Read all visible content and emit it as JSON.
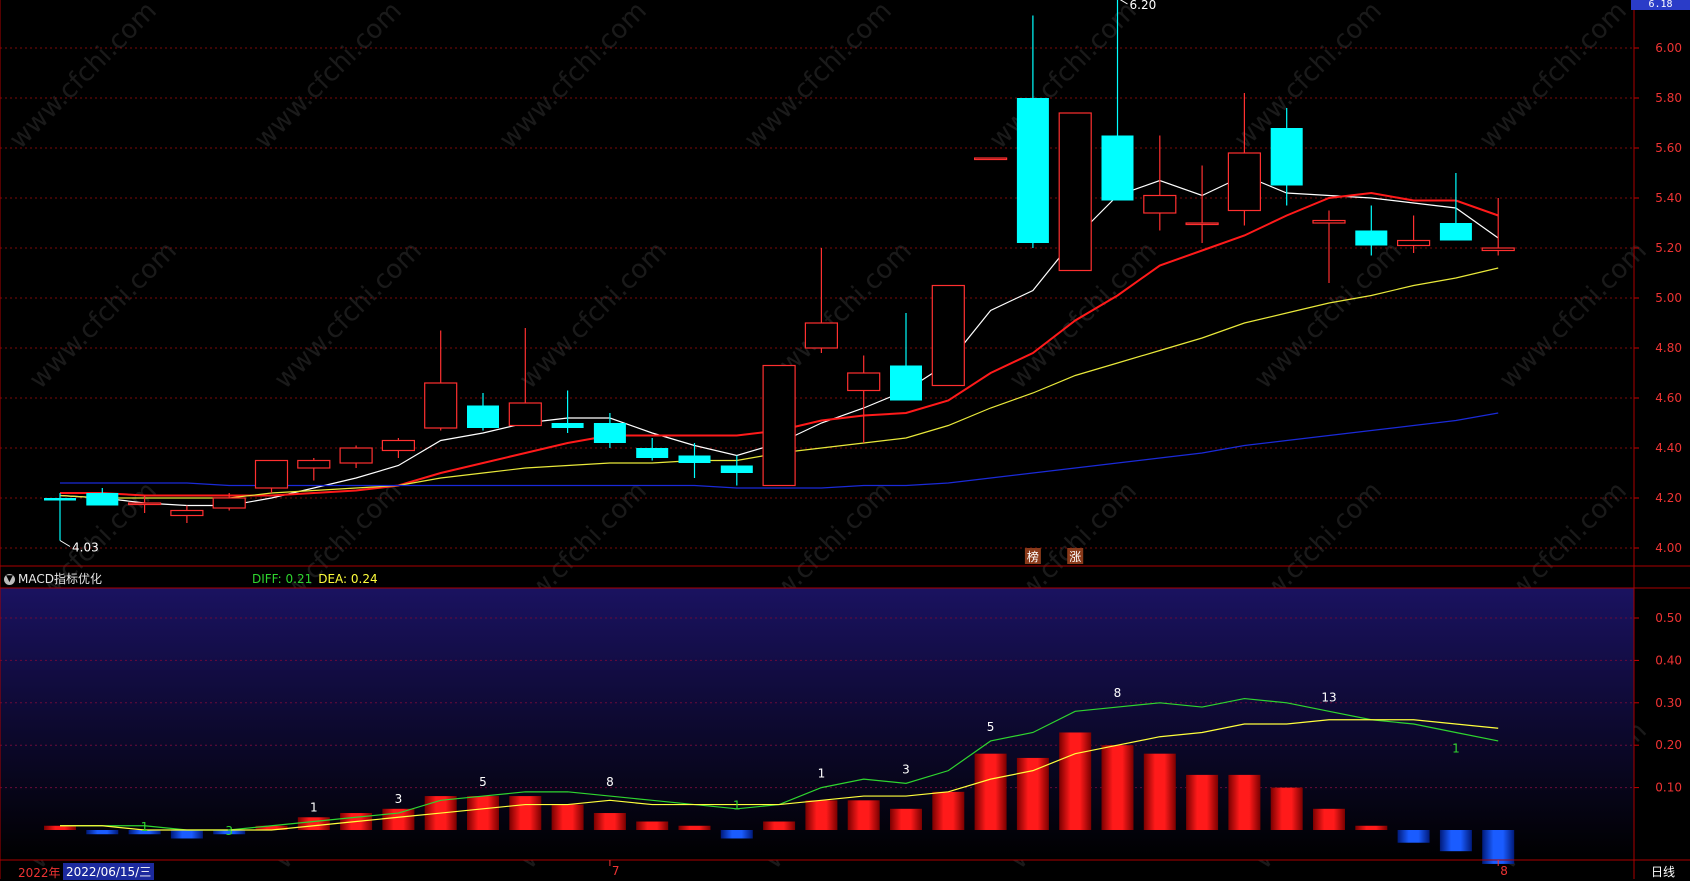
{
  "header_badge": "6.18",
  "macd_panel": {
    "title": "MACD指标优化",
    "diff_label": "DIFF: 0.21",
    "dea_label": "DEA: 0.24"
  },
  "bottom_axis": {
    "year": "2022年",
    "cursor_date": "2022/06/15/三",
    "period": "日线",
    "month_marks": [
      "7",
      "8"
    ]
  },
  "chart_data": [
    {
      "type": "candlestick",
      "yaxis_ticks": [
        "4.00",
        "4.20",
        "4.40",
        "4.60",
        "4.80",
        "5.00",
        "5.20",
        "5.40",
        "5.60",
        "5.80",
        "6.00"
      ],
      "ylim": [
        3.98,
        6.23
      ],
      "high_label": "6.20",
      "low_label": "4.03",
      "markers": [
        "榜",
        "涨"
      ],
      "colors": {
        "up": "#ff3030",
        "down": "#00ffff",
        "ma5": "#ffffff",
        "ma10": "#ff1a1a",
        "ma20": "#e8e83a",
        "ma60": "#1a2ad8"
      },
      "candles": [
        {
          "o": 4.2,
          "h": 4.22,
          "l": 4.03,
          "c": 4.19
        },
        {
          "o": 4.22,
          "h": 4.24,
          "l": 4.17,
          "c": 4.17
        },
        {
          "o": 4.18,
          "h": 4.21,
          "l": 4.14,
          "c": 4.18
        },
        {
          "o": 4.13,
          "h": 4.17,
          "l": 4.1,
          "c": 4.15
        },
        {
          "o": 4.16,
          "h": 4.22,
          "l": 4.15,
          "c": 4.2
        },
        {
          "o": 4.24,
          "h": 4.35,
          "l": 4.22,
          "c": 4.35
        },
        {
          "o": 4.32,
          "h": 4.36,
          "l": 4.27,
          "c": 4.35
        },
        {
          "o": 4.34,
          "h": 4.41,
          "l": 4.32,
          "c": 4.4
        },
        {
          "o": 4.39,
          "h": 4.44,
          "l": 4.36,
          "c": 4.43
        },
        {
          "o": 4.48,
          "h": 4.87,
          "l": 4.47,
          "c": 4.66
        },
        {
          "o": 4.57,
          "h": 4.62,
          "l": 4.47,
          "c": 4.48
        },
        {
          "o": 4.49,
          "h": 4.88,
          "l": 4.49,
          "c": 4.58
        },
        {
          "o": 4.5,
          "h": 4.63,
          "l": 4.46,
          "c": 4.48
        },
        {
          "o": 4.5,
          "h": 4.54,
          "l": 4.4,
          "c": 4.42
        },
        {
          "o": 4.4,
          "h": 4.44,
          "l": 4.35,
          "c": 4.36
        },
        {
          "o": 4.37,
          "h": 4.42,
          "l": 4.28,
          "c": 4.34
        },
        {
          "o": 4.33,
          "h": 4.37,
          "l": 4.25,
          "c": 4.3
        },
        {
          "o": 4.25,
          "h": 4.73,
          "l": 4.25,
          "c": 4.73
        },
        {
          "o": 4.8,
          "h": 5.2,
          "l": 4.78,
          "c": 4.9
        },
        {
          "o": 4.63,
          "h": 4.77,
          "l": 4.42,
          "c": 4.7
        },
        {
          "o": 4.73,
          "h": 4.94,
          "l": 4.59,
          "c": 4.59
        },
        {
          "o": 4.65,
          "h": 5.05,
          "l": 4.65,
          "c": 5.05
        },
        {
          "o": 5.56,
          "h": 5.56,
          "l": 5.56,
          "c": 5.56
        },
        {
          "o": 5.8,
          "h": 6.13,
          "l": 5.2,
          "c": 5.22
        },
        {
          "o": 5.11,
          "h": 5.74,
          "l": 5.11,
          "c": 5.74
        },
        {
          "o": 5.65,
          "h": 6.2,
          "l": 5.39,
          "c": 5.39
        },
        {
          "o": 5.34,
          "h": 5.65,
          "l": 5.27,
          "c": 5.41
        },
        {
          "o": 5.3,
          "h": 5.53,
          "l": 5.22,
          "c": 5.3
        },
        {
          "o": 5.35,
          "h": 5.82,
          "l": 5.29,
          "c": 5.58
        },
        {
          "o": 5.68,
          "h": 5.76,
          "l": 5.37,
          "c": 5.45
        },
        {
          "o": 5.3,
          "h": 5.35,
          "l": 5.06,
          "c": 5.31
        },
        {
          "o": 5.27,
          "h": 5.37,
          "l": 5.17,
          "c": 5.21
        },
        {
          "o": 5.21,
          "h": 5.33,
          "l": 5.18,
          "c": 5.23
        },
        {
          "o": 5.3,
          "h": 5.5,
          "l": 5.23,
          "c": 5.23
        },
        {
          "o": 5.19,
          "h": 5.4,
          "l": 5.17,
          "c": 5.2
        }
      ],
      "ma_lines": [
        {
          "name": "MA5",
          "values": [
            4.21,
            4.2,
            4.18,
            4.17,
            4.17,
            4.2,
            4.24,
            4.28,
            4.33,
            4.43,
            4.46,
            4.5,
            4.52,
            4.52,
            4.46,
            4.41,
            4.37,
            4.42,
            4.5,
            4.56,
            4.63,
            4.74,
            4.95,
            5.03,
            5.24,
            5.41,
            5.47,
            5.41,
            5.49,
            5.42,
            5.41,
            5.4,
            5.38,
            5.36,
            5.24
          ]
        },
        {
          "name": "MA10",
          "values": [
            4.22,
            4.22,
            4.21,
            4.21,
            4.21,
            4.21,
            4.22,
            4.23,
            4.25,
            4.3,
            4.34,
            4.38,
            4.42,
            4.45,
            4.45,
            4.45,
            4.45,
            4.47,
            4.51,
            4.53,
            4.54,
            4.59,
            4.7,
            4.78,
            4.91,
            5.01,
            5.13,
            5.19,
            5.25,
            5.33,
            5.4,
            5.42,
            5.39,
            5.39,
            5.33
          ]
        },
        {
          "name": "MA20",
          "values": [
            4.21,
            4.2,
            4.2,
            4.2,
            4.2,
            4.22,
            4.23,
            4.24,
            4.25,
            4.28,
            4.3,
            4.32,
            4.33,
            4.34,
            4.34,
            4.35,
            4.35,
            4.38,
            4.4,
            4.42,
            4.44,
            4.49,
            4.56,
            4.62,
            4.69,
            4.74,
            4.79,
            4.84,
            4.9,
            4.94,
            4.98,
            5.01,
            5.05,
            5.08,
            5.12
          ]
        },
        {
          "name": "MA60",
          "values": [
            4.26,
            4.26,
            4.26,
            4.26,
            4.25,
            4.25,
            4.25,
            4.25,
            4.25,
            4.25,
            4.25,
            4.25,
            4.25,
            4.25,
            4.25,
            4.25,
            4.24,
            4.24,
            4.24,
            4.25,
            4.25,
            4.26,
            4.28,
            4.3,
            4.32,
            4.34,
            4.36,
            4.38,
            4.41,
            4.43,
            4.45,
            4.47,
            4.49,
            4.51,
            4.54
          ]
        }
      ]
    },
    {
      "type": "bar",
      "name": "MACD",
      "yaxis_ticks": [
        "0.10",
        "0.20",
        "0.30",
        "0.40",
        "0.50"
      ],
      "ylim": [
        -0.08,
        0.57
      ],
      "histogram": [
        0.01,
        -0.01,
        -0.01,
        -0.02,
        -0.01,
        0.01,
        0.03,
        0.04,
        0.05,
        0.08,
        0.08,
        0.08,
        0.06,
        0.04,
        0.02,
        0.01,
        -0.02,
        0.02,
        0.07,
        0.07,
        0.05,
        0.09,
        0.18,
        0.17,
        0.23,
        0.2,
        0.18,
        0.13,
        0.13,
        0.1,
        0.05,
        0.01,
        -0.03,
        -0.05,
        -0.08
      ],
      "diff": [
        0.01,
        0.01,
        0.01,
        0.0,
        0.0,
        0.01,
        0.02,
        0.03,
        0.04,
        0.07,
        0.08,
        0.09,
        0.09,
        0.08,
        0.07,
        0.06,
        0.05,
        0.06,
        0.1,
        0.12,
        0.11,
        0.14,
        0.21,
        0.23,
        0.28,
        0.29,
        0.3,
        0.29,
        0.31,
        0.3,
        0.28,
        0.26,
        0.25,
        0.23,
        0.21
      ],
      "dea": [
        0.01,
        0.01,
        0.0,
        0.0,
        0.0,
        0.0,
        0.01,
        0.02,
        0.03,
        0.04,
        0.05,
        0.06,
        0.06,
        0.07,
        0.06,
        0.06,
        0.06,
        0.06,
        0.07,
        0.08,
        0.08,
        0.09,
        0.12,
        0.14,
        0.18,
        0.2,
        0.22,
        0.23,
        0.25,
        0.25,
        0.26,
        0.26,
        0.26,
        0.25,
        0.24
      ],
      "annotations": [
        {
          "index": 2,
          "text": "1",
          "color": "#2fd52f",
          "pos": "on-line"
        },
        {
          "index": 4,
          "text": "3",
          "color": "#2fd52f",
          "pos": "on-line"
        },
        {
          "index": 6,
          "text": "1",
          "color": "#ffffff",
          "pos": "above"
        },
        {
          "index": 8,
          "text": "3",
          "color": "#ffffff",
          "pos": "above"
        },
        {
          "index": 10,
          "text": "5",
          "color": "#ffffff",
          "pos": "above"
        },
        {
          "index": 13,
          "text": "8",
          "color": "#ffffff",
          "pos": "above"
        },
        {
          "index": 16,
          "text": "1",
          "color": "#2fd52f",
          "pos": "on-line"
        },
        {
          "index": 18,
          "text": "1",
          "color": "#ffffff",
          "pos": "above"
        },
        {
          "index": 20,
          "text": "3",
          "color": "#ffffff",
          "pos": "above"
        },
        {
          "index": 22,
          "text": "5",
          "color": "#ffffff",
          "pos": "above"
        },
        {
          "index": 25,
          "text": "8",
          "color": "#ffffff",
          "pos": "above"
        },
        {
          "index": 30,
          "text": "13",
          "color": "#ffffff",
          "pos": "above"
        },
        {
          "index": 33,
          "text": "1",
          "color": "#2fd52f",
          "pos": "below"
        }
      ]
    }
  ]
}
